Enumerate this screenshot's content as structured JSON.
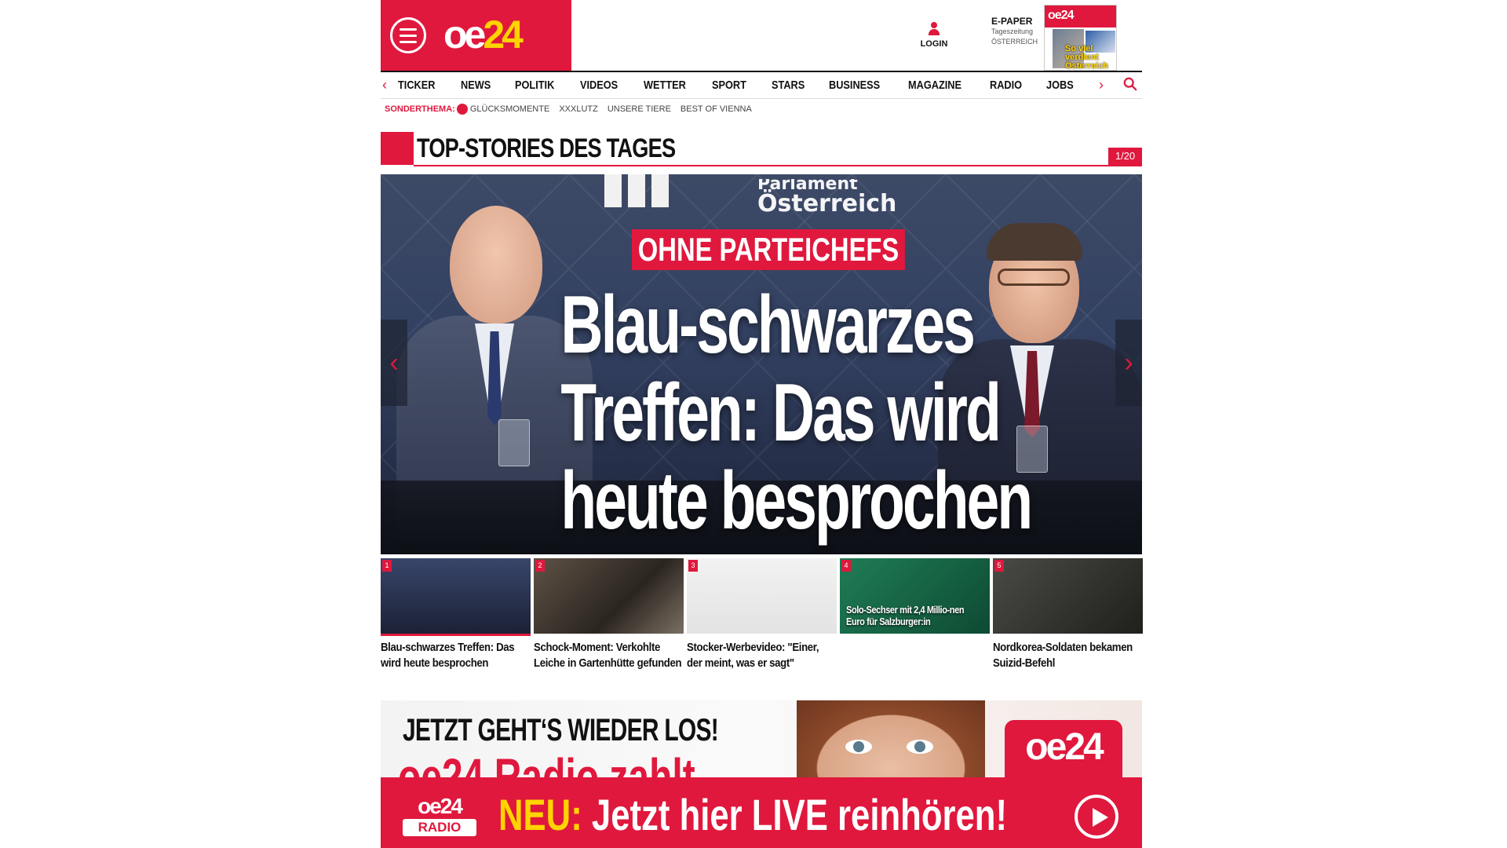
{
  "header": {
    "logo_oe": "oe",
    "logo_num": "24",
    "login_label": "LOGIN",
    "epaper_title": "E-PAPER",
    "epaper_sub1": "Tageszeitung",
    "epaper_sub2": "ÖSTERREICH",
    "epaper_cover_logo": "oe24",
    "epaper_cover_text": "So viel verdient Österreich"
  },
  "nav": {
    "items": [
      "TICKER",
      "NEWS",
      "POLITIK",
      "VIDEOS",
      "WETTER",
      "SPORT",
      "STARS",
      "BUSINESS",
      "MAGAZINE",
      "RADIO",
      "JOBS"
    ]
  },
  "subnav": {
    "label": "SONDERTHEMA:",
    "items": [
      "GLÜCKSMOMENTE",
      "XXXLUTZ",
      "UNSERE TIERE",
      "BEST OF VIENNA"
    ]
  },
  "section": {
    "title": "TOP-STORIES DES TAGES",
    "counter": "1/20"
  },
  "hero": {
    "backdrop_text_line1": "Parlament",
    "backdrop_text_line2": "Österreich",
    "kicker": "OHNE PARTEICHEFS",
    "headline_line1": "Blau-schwarzes",
    "headline_line2": "Treffen: Das wird",
    "headline_line3": "heute besprochen"
  },
  "thumbs": [
    {
      "num": "1",
      "title": "Blau-schwarzes Treffen: Das wird heute besprochen",
      "overlay": ""
    },
    {
      "num": "2",
      "title": "Schock-Moment: Verkohlte Leiche in Gartenhütte gefunden",
      "overlay": ""
    },
    {
      "num": "3",
      "title": "Stocker-Werbevideo: \"Einer, der meint, was er sagt\"",
      "overlay": ""
    },
    {
      "num": "4",
      "title": "",
      "overlay": "Solo-Sechser mit 2,4 Millio-nen Euro für Salzburger:in"
    },
    {
      "num": "5",
      "title": "Nordkorea-Soldaten bekamen Suizid-Befehl",
      "overlay": ""
    }
  ],
  "ad": {
    "title": "JETZT GEHT‘S WIEDER LOS!",
    "sub": "oe24 Radio zahlt",
    "logo": "oe24"
  },
  "radio_bar": {
    "logo_top": "oe24",
    "logo_bottom": "RADIO",
    "neu": "NEU:",
    "cta": "Jetzt hier LIVE reinhören!"
  },
  "colors": {
    "brand_red": "#e0183d",
    "accent_yellow": "#ffd400"
  },
  "icons": {
    "menu": "hamburger-icon",
    "login": "user-icon",
    "search": "search-icon",
    "play": "play-icon",
    "prev": "chevron-left-icon",
    "next": "chevron-right-icon"
  }
}
